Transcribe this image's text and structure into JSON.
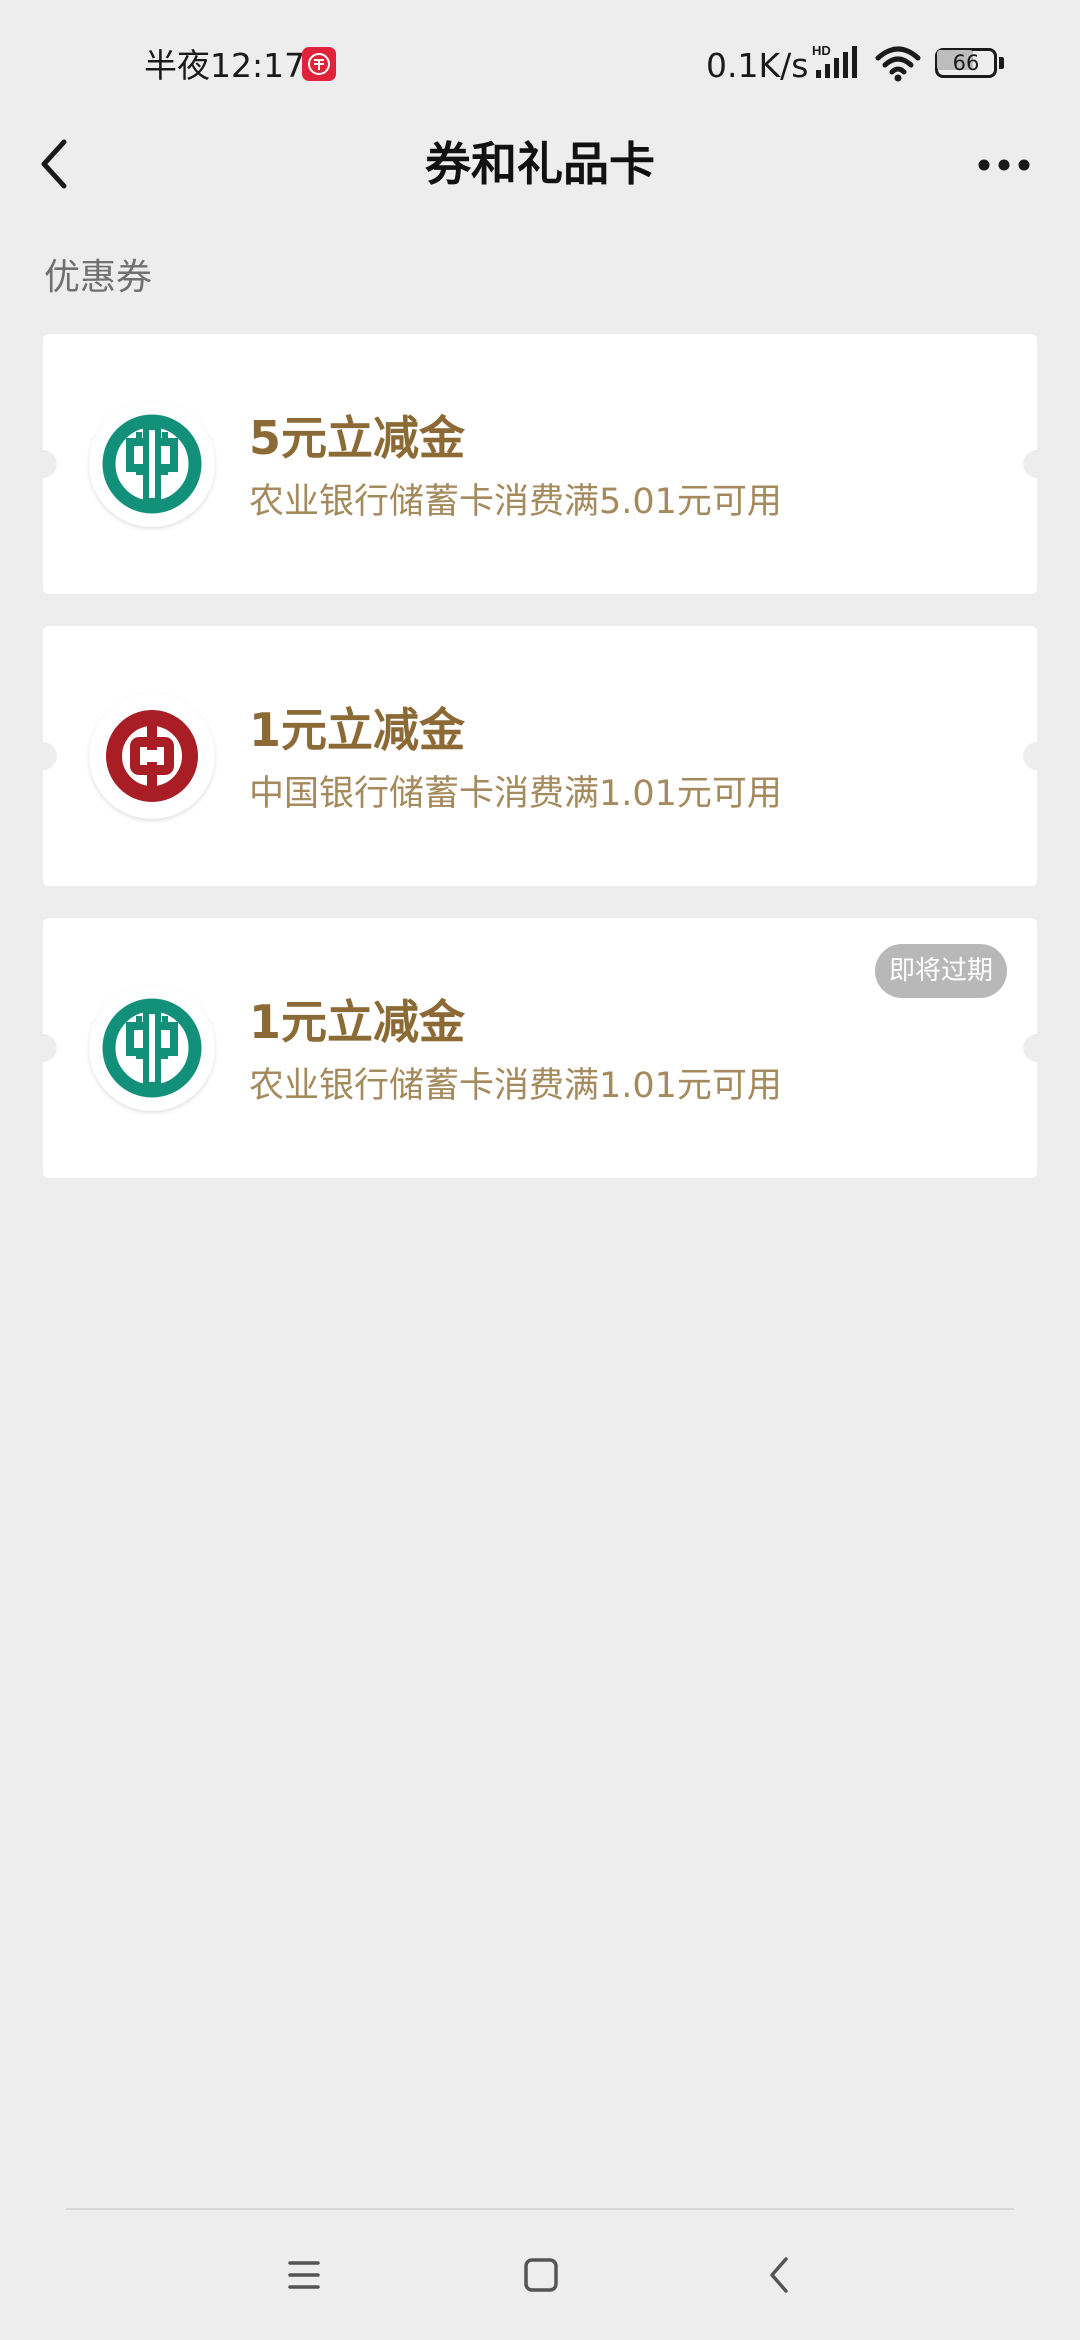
{
  "status_bar": {
    "time": "半夜12:17",
    "network_speed": "0.1K/s",
    "battery_level": "66",
    "battery_fraction": 0.66,
    "hd_label": "HD"
  },
  "nav": {
    "title": "券和礼品卡"
  },
  "section": {
    "title": "优惠券"
  },
  "coupons": [
    {
      "title": "5元立减金",
      "description": "农业银行储蓄卡消费满5.01元可用",
      "bank_icon": "abc-bank-logo-icon",
      "badge": ""
    },
    {
      "title": "1元立减金",
      "description": "中国银行储蓄卡消费满1.01元可用",
      "bank_icon": "boc-bank-logo-icon",
      "badge": ""
    },
    {
      "title": "1元立减金",
      "description": "农业银行储蓄卡消费满1.01元可用",
      "bank_icon": "abc-bank-logo-icon",
      "badge": "即将过期"
    }
  ],
  "colors": {
    "abc_green": "#12907a",
    "boc_red": "#a81e24",
    "coupon_title": "#8c6a36",
    "coupon_desc": "#a48a5c",
    "background": "#ededed"
  },
  "system_nav": {
    "icons": [
      "menu-icon",
      "home-icon",
      "back-icon"
    ]
  }
}
